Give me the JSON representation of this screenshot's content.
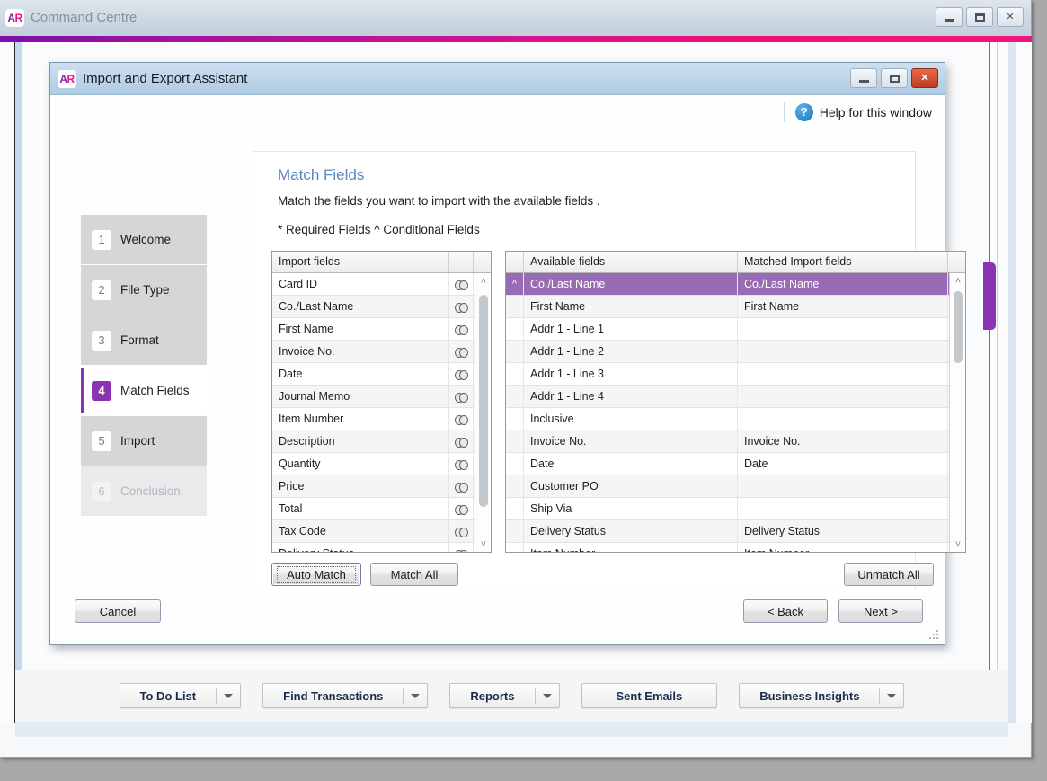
{
  "app_window": {
    "logo": "AR",
    "title": "Command Centre",
    "minimize_label": "–",
    "maximize_label": "□",
    "close_label": "✕",
    "accent_color": "#d4128f"
  },
  "dialog": {
    "logo": "AR",
    "title": "Import and Export Assistant",
    "minimize_label": "–",
    "maximize_label": "□",
    "close_label": "✕",
    "help": {
      "icon": "question-mark-icon",
      "label": "Help for this window"
    }
  },
  "steps": [
    {
      "num": "1",
      "label": "Welcome",
      "state": "done"
    },
    {
      "num": "2",
      "label": "File Type",
      "state": "done"
    },
    {
      "num": "3",
      "label": "Format",
      "state": "done"
    },
    {
      "num": "4",
      "label": "Match Fields",
      "state": "active"
    },
    {
      "num": "5",
      "label": "Import",
      "state": "done"
    },
    {
      "num": "6",
      "label": "Conclusion",
      "state": "disabled"
    }
  ],
  "panel": {
    "heading": "Match Fields",
    "subheading": "Match the fields you want to import with the available fields .",
    "legend": "* Required Fields ^ Conditional Fields",
    "accent_color": "#8b33b5",
    "heading_color": "#5b86c0"
  },
  "import_list": {
    "header": "Import fields",
    "link_icon": "link-icon",
    "rows": [
      {
        "name": "Card ID"
      },
      {
        "name": "Co./Last Name"
      },
      {
        "name": "First Name"
      },
      {
        "name": "Invoice No."
      },
      {
        "name": "Date"
      },
      {
        "name": "Journal Memo"
      },
      {
        "name": "Item Number"
      },
      {
        "name": "Description"
      },
      {
        "name": "Quantity"
      },
      {
        "name": "Price"
      },
      {
        "name": "Total"
      },
      {
        "name": "Tax Code"
      },
      {
        "name": "Delivery Status"
      }
    ],
    "scroll_up": "˄",
    "scroll_down": "˅"
  },
  "available_list": {
    "header_available": "Available fields",
    "header_matched": "Matched Import fields",
    "selected_color": "#9a6bb5",
    "rows": [
      {
        "mark": "^",
        "available": "Co./Last Name",
        "matched": "Co./Last Name",
        "selected": true
      },
      {
        "mark": "",
        "available": "First Name",
        "matched": "First Name",
        "selected": false
      },
      {
        "mark": "",
        "available": "Addr 1 - Line 1",
        "matched": "",
        "selected": false
      },
      {
        "mark": "",
        "available": "Addr 1 - Line 2",
        "matched": "",
        "selected": false
      },
      {
        "mark": "",
        "available": "Addr 1 - Line 3",
        "matched": "",
        "selected": false
      },
      {
        "mark": "",
        "available": "Addr 1 - Line 4",
        "matched": "",
        "selected": false
      },
      {
        "mark": "",
        "available": "Inclusive",
        "matched": "",
        "selected": false
      },
      {
        "mark": "",
        "available": "Invoice No.",
        "matched": "Invoice No.",
        "selected": false
      },
      {
        "mark": "",
        "available": "Date",
        "matched": "Date",
        "selected": false
      },
      {
        "mark": "",
        "available": "Customer PO",
        "matched": "",
        "selected": false
      },
      {
        "mark": "",
        "available": "Ship Via",
        "matched": "",
        "selected": false
      },
      {
        "mark": "",
        "available": "Delivery Status",
        "matched": "Delivery Status",
        "selected": false
      },
      {
        "mark": "",
        "available": "Item Number",
        "matched": "Item Number",
        "selected": false
      }
    ],
    "scroll_up": "˄",
    "scroll_down": "˅"
  },
  "buttons": {
    "auto_match": "Auto Match",
    "match_all": "Match All",
    "unmatch_all": "Unmatch All",
    "cancel": "Cancel",
    "back": "< Back",
    "next": "Next >"
  },
  "command_bar": [
    {
      "label": "To Do List",
      "has_dropdown": true
    },
    {
      "label": "Find Transactions",
      "has_dropdown": true
    },
    {
      "label": "Reports",
      "has_dropdown": true
    },
    {
      "label": "Sent Emails",
      "has_dropdown": false
    },
    {
      "label": "Business Insights",
      "has_dropdown": true
    }
  ]
}
